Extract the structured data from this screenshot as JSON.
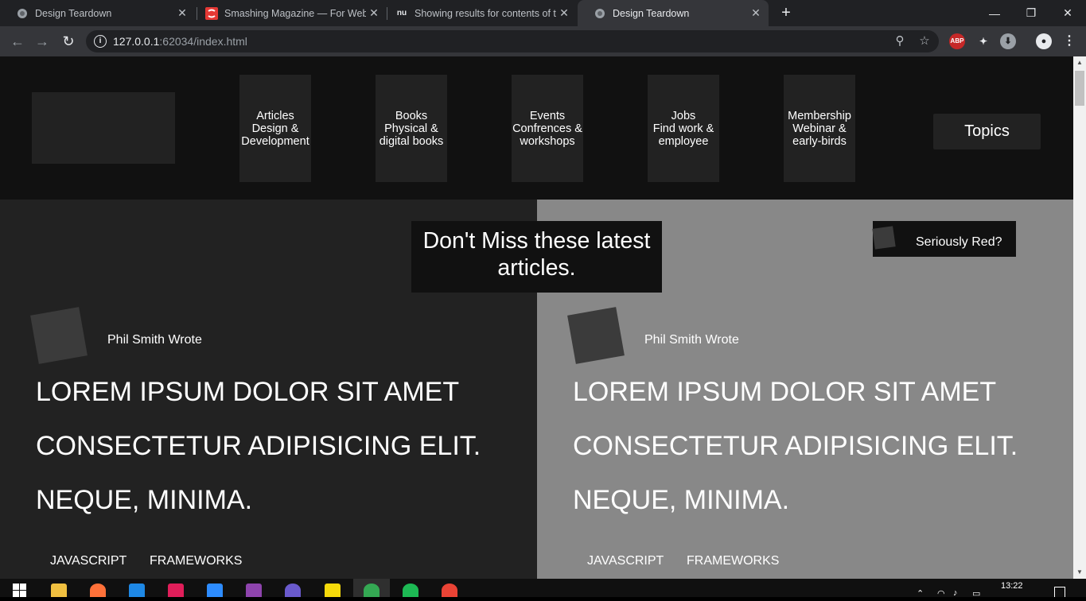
{
  "browser": {
    "tabs": [
      {
        "title": "Design Teardown",
        "favicon": "globe-icon",
        "active": false
      },
      {
        "title": "Smashing Magazine — For Web D",
        "favicon": "smashing-s-icon",
        "active": false
      },
      {
        "title": "Showing results for contents of t",
        "favicon": "nu-icon",
        "active": false
      },
      {
        "title": "Design Teardown",
        "favicon": "globe-icon",
        "active": true
      }
    ],
    "address": {
      "host": "127.0.0.1",
      "path": ":62034/index.html"
    }
  },
  "site": {
    "nav": [
      {
        "line1": "Articles",
        "line2": "Design &",
        "line3": "Development"
      },
      {
        "line1": "Books",
        "line2": "Physical &",
        "line3": "digital books"
      },
      {
        "line1": "Events",
        "line2": "Confrences &",
        "line3": "workshops"
      },
      {
        "line1": "Jobs",
        "line2": "Find work &",
        "line3": "employee"
      },
      {
        "line1": "Membership",
        "line2": "Webinar &",
        "line3": "early-birds"
      }
    ],
    "topics_label": "Topics",
    "banner": "Don't Miss these latest articles.",
    "red_toggle_label": "Seriously Red?",
    "articles": [
      {
        "author": "Phil Smith Wrote",
        "headline": "Lorem ipsum dolor sit amet consectetur adipisicing elit. Neque, minima.",
        "tags": [
          "Javascript",
          "Frameworks"
        ]
      },
      {
        "author": "Phil Smith Wrote",
        "headline": "Lorem ipsum dolor sit amet consectetur adipisicing elit. Neque, minima.",
        "tags": [
          "Javascript",
          "Frameworks"
        ]
      }
    ]
  },
  "taskbar": {
    "clock": "13:22"
  },
  "colors": {
    "header_bg": "#111111",
    "panel_dark": "#222222",
    "panel_grey": "#888888",
    "tile": "#3b3b3b"
  }
}
